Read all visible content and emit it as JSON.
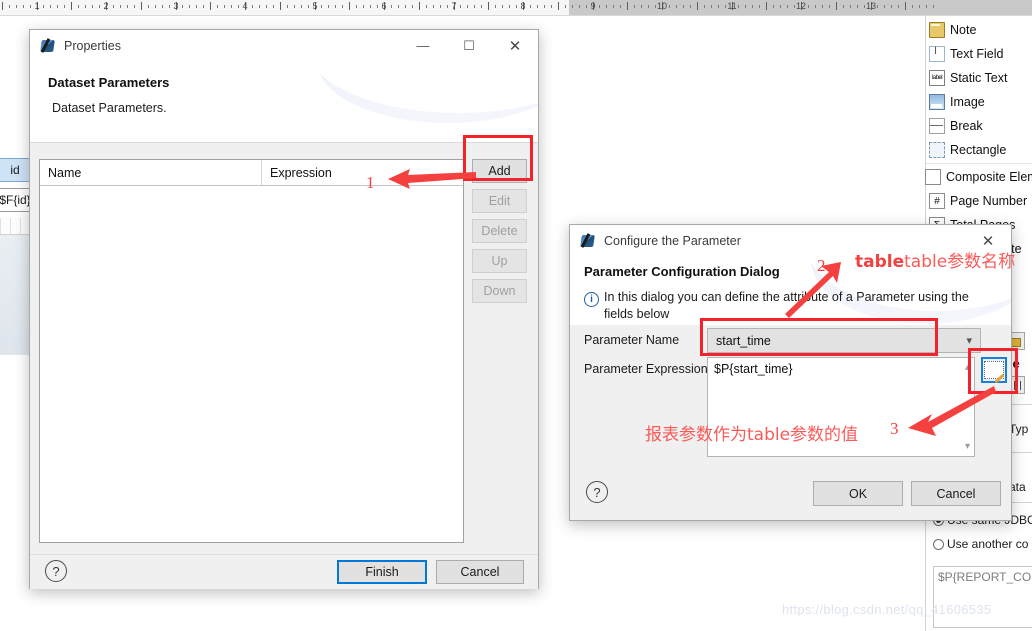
{
  "ruler": {
    "unit_labels": [
      "1",
      "2",
      "3",
      "4",
      "5",
      "6",
      "7",
      "8",
      "9",
      "10",
      "11",
      "12",
      "13"
    ]
  },
  "report_canvas": {
    "column_header_cell": "id",
    "detail_cell": "$F{id}"
  },
  "palette": {
    "items": [
      {
        "label": "Note",
        "icon": "note-icon"
      },
      {
        "label": "Text Field",
        "icon": "text-field-icon"
      },
      {
        "label": "Static Text",
        "icon": "static-text-icon"
      },
      {
        "label": "Image",
        "icon": "image-icon"
      },
      {
        "label": "Break",
        "icon": "break-icon"
      },
      {
        "label": "Rectangle",
        "icon": "rectangle-icon"
      },
      {
        "label": "Composite Eleme",
        "icon": "composite-element-icon"
      },
      {
        "label": "Page Number",
        "icon": "page-number-icon"
      },
      {
        "label": "Total Pages",
        "icon": "total-pages-icon"
      },
      {
        "label": "Current Date",
        "icon": "current-date-icon"
      }
    ]
  },
  "right_panel": {
    "table_label": "b e",
    "type_label": "Typ",
    "data_label": "ata",
    "radio_same_connection": "Use same JDBC",
    "radio_another_connection": "Use another co",
    "connection_expression": "$P{REPORT_CON"
  },
  "properties_dialog": {
    "title": "Properties",
    "heading": "Dataset Parameters",
    "subheading": "Dataset Parameters.",
    "columns": [
      "Name",
      "Expression"
    ],
    "rows": [],
    "buttons": {
      "add": "Add",
      "edit": "Edit",
      "delete": "Delete",
      "up": "Up",
      "down": "Down",
      "finish": "Finish",
      "cancel": "Cancel",
      "help": "?"
    },
    "window_controls": {
      "minimize": "—",
      "maximize": "☐",
      "close": "✕"
    }
  },
  "configure_dialog": {
    "title": "Configure the Parameter",
    "heading": "Parameter Configuration Dialog",
    "info_text": "In this dialog you can define the attribute of a Parameter using the fields below",
    "fields": {
      "parameter_name_label": "Parameter Name",
      "parameter_name_value": "start_time",
      "parameter_expression_label": "Parameter Expression",
      "parameter_expression_value": "$P{start_time}"
    },
    "buttons": {
      "ok": "OK",
      "cancel": "Cancel",
      "help": "?",
      "close": "✕",
      "edit_expression": "edit-expression-icon"
    }
  },
  "annotations": {
    "marker1": "1",
    "marker2": "2",
    "marker3": "3",
    "note_table_param_name": "table参数名称",
    "note_report_param_value": "报表参数作为table参数的值",
    "accent_color": "#f4222a"
  },
  "watermark": {
    "text": "https://blog.csdn.net/qq_41606535"
  }
}
